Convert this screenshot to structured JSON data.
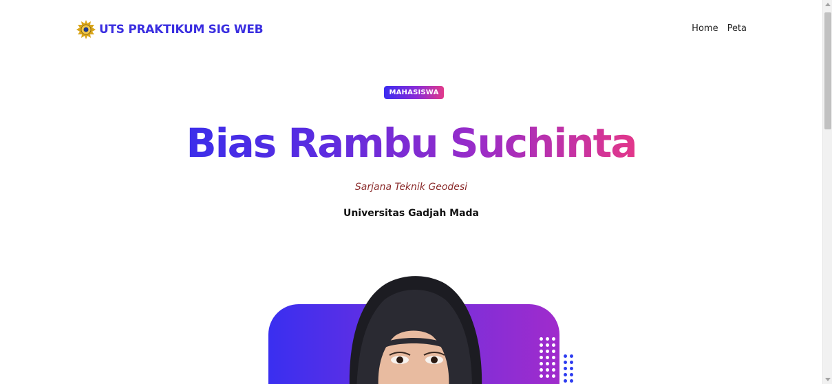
{
  "navbar": {
    "brand_logo": "university-seal-icon",
    "brand_text": "UTS PRAKTIKUM SIG WEB",
    "links": [
      {
        "label": "Home"
      },
      {
        "label": "Peta"
      }
    ]
  },
  "hero": {
    "badge": "MAHASISWA",
    "name": "Bias Rambu Suchinta",
    "degree": "Sarjana Teknik Geodesi",
    "university": "Universitas Gadjah Mada"
  },
  "colors": {
    "brand": "#3a2ee0",
    "gradient_start": "#3b2cf0",
    "gradient_mid": "#8b2bd6",
    "gradient_end": "#e23a8a",
    "degree_text": "#8a2a2a"
  }
}
